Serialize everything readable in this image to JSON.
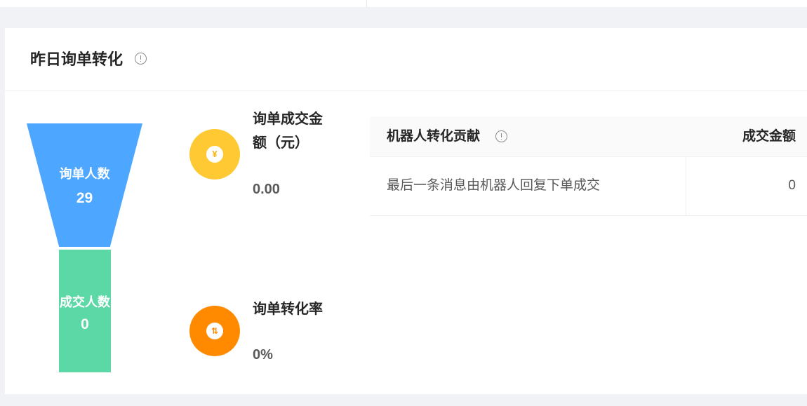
{
  "section": {
    "title": "昨日询单转化"
  },
  "funnel": {
    "inquiry_label": "询单人数",
    "inquiry_value": "29",
    "deal_label": "成交人数",
    "deal_value": "0"
  },
  "metrics": [
    {
      "label": "询单成交金额（元）",
      "value": "0.00",
      "icon": "yen-icon",
      "color": "#ffc933",
      "glyph": "¥"
    },
    {
      "label": "询单转化率",
      "value": "0%",
      "icon": "exchange-arrows-icon",
      "color": "#ff8a00",
      "glyph": "⇅"
    }
  ],
  "table": {
    "headers": [
      "机器人转化贡献",
      "成交金额"
    ],
    "rows": [
      [
        "最后一条消息由机器人回复下单成交",
        "0"
      ]
    ]
  },
  "colors": {
    "funnel_top": "#4da6ff",
    "funnel_bottom": "#5cd8a6"
  }
}
